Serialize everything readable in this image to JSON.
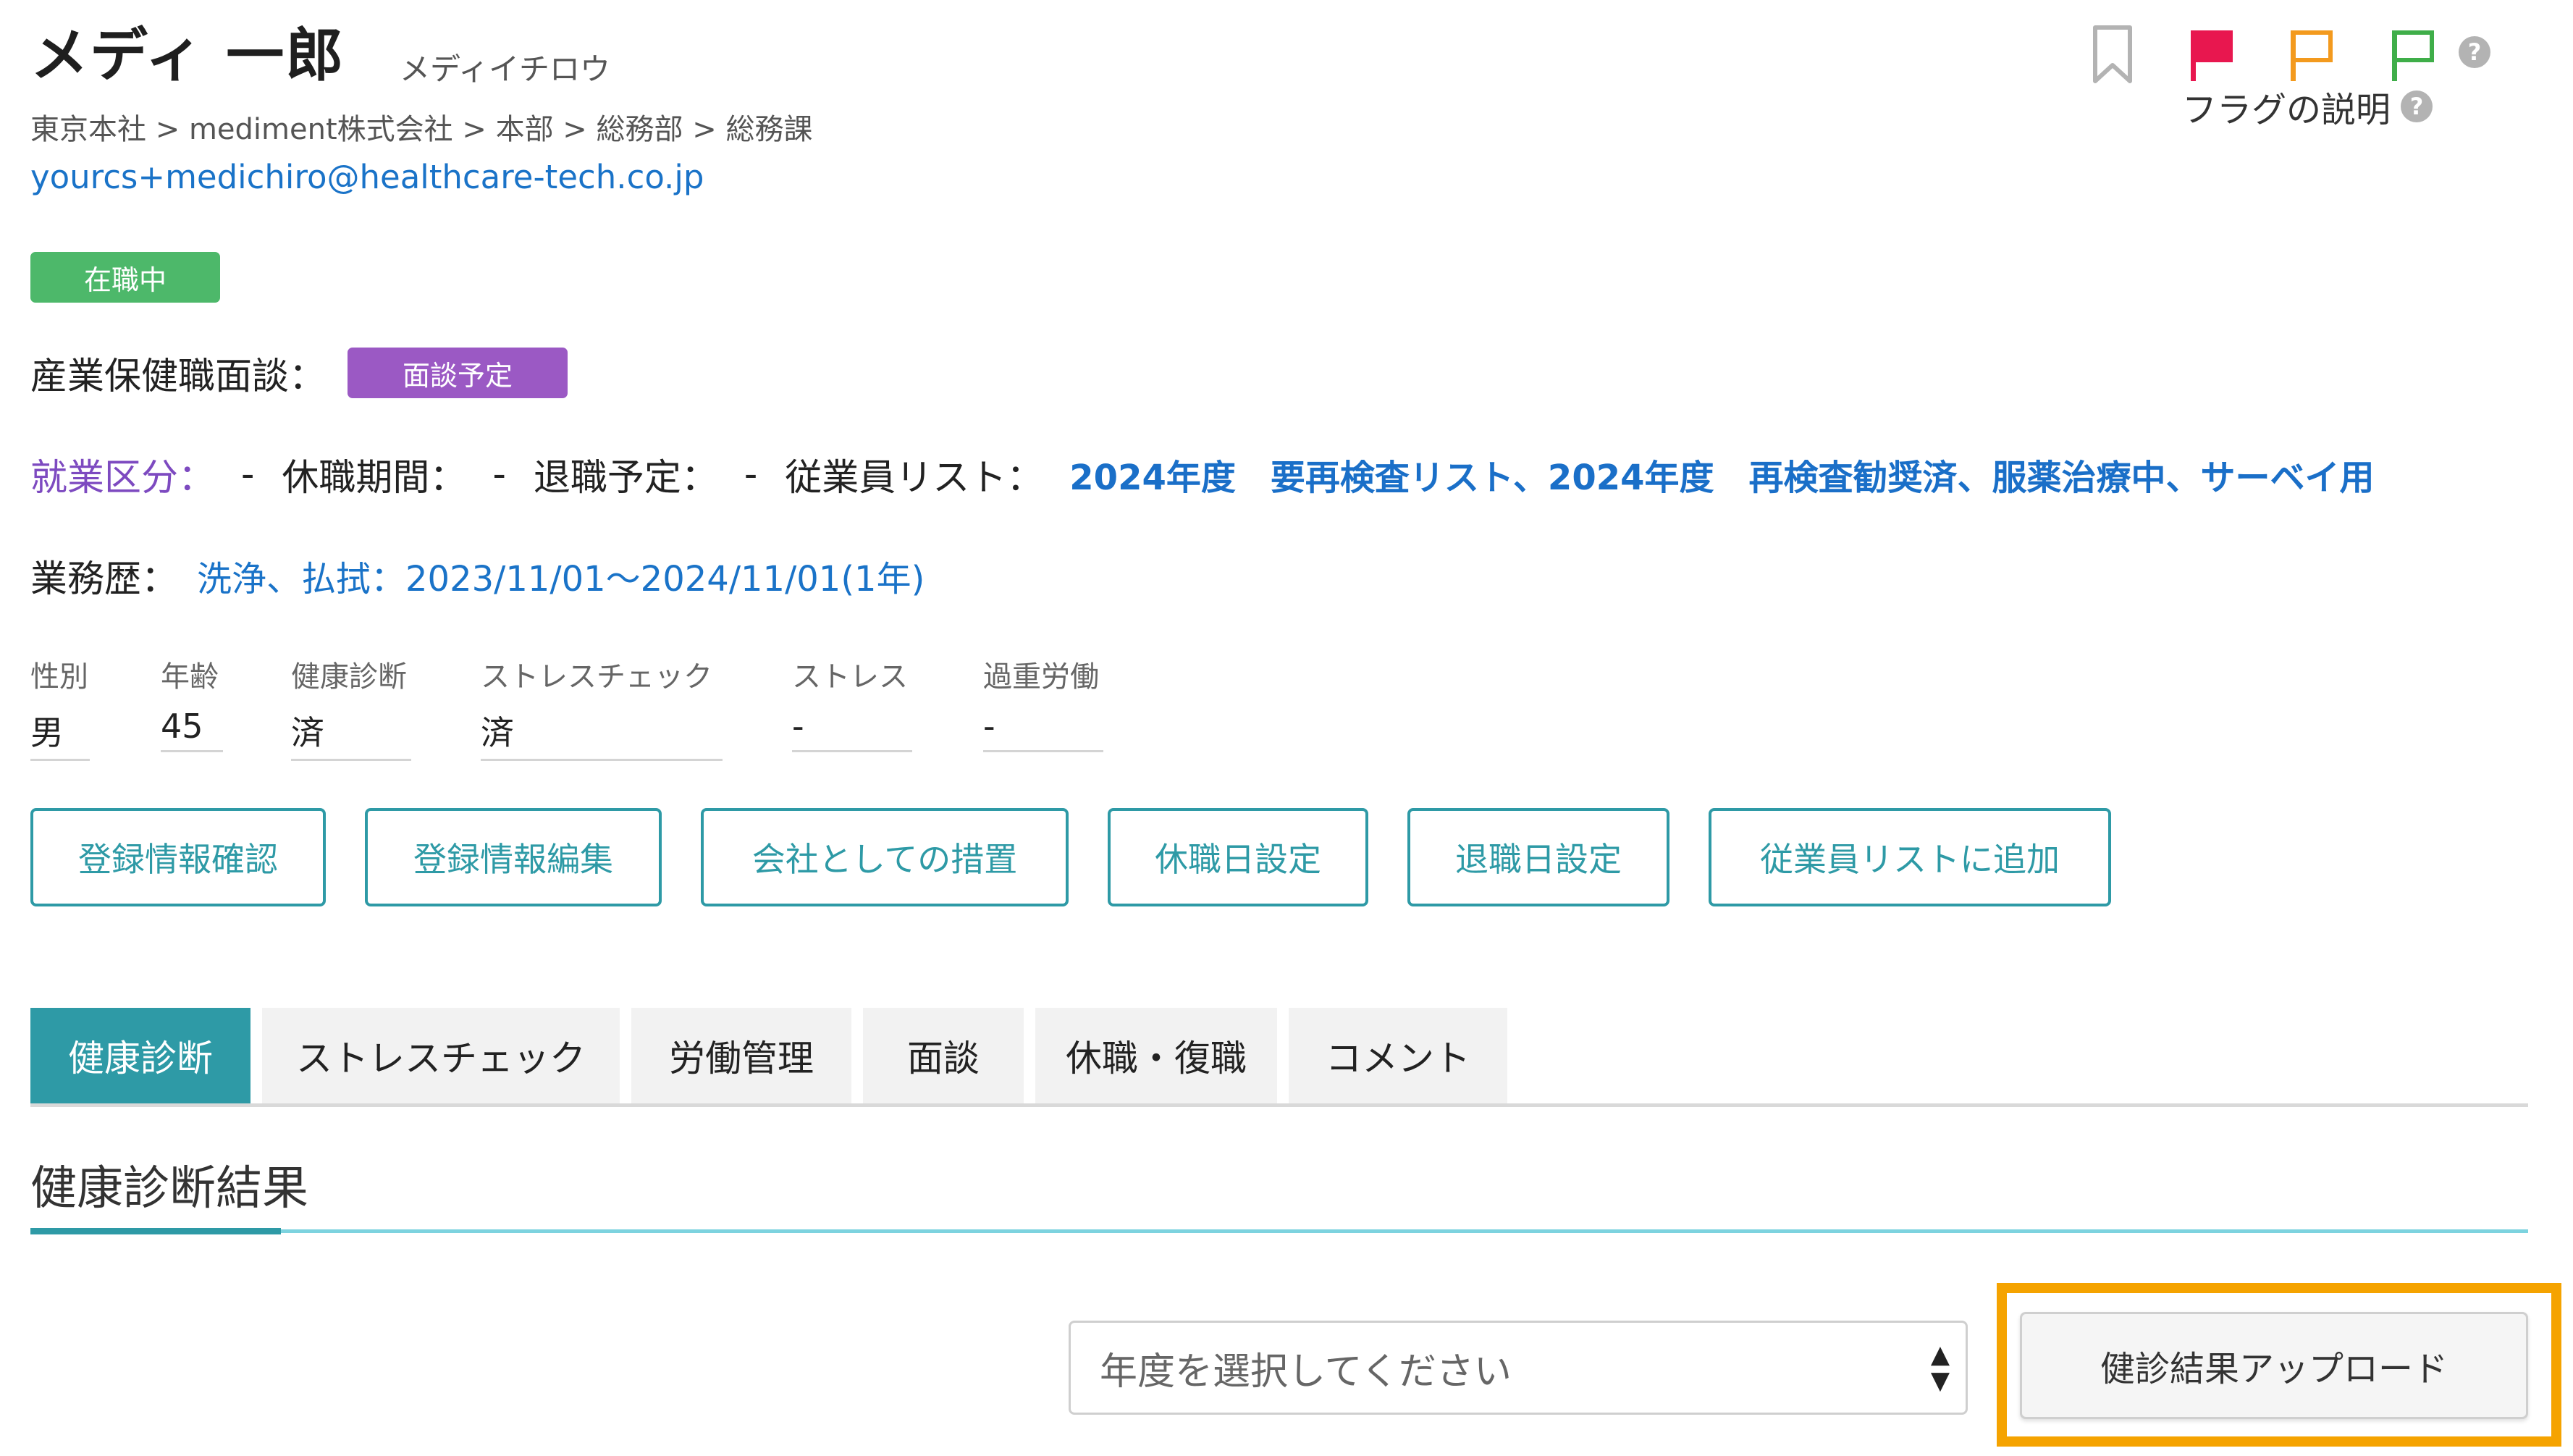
{
  "employee": {
    "name": "メディ 一郎",
    "kana": "メディイチロウ",
    "breadcrumb": "東京本社 > mediment株式会社 > 本部 > 総務部 > 総務課",
    "email": "yourcs+medichiro@healthcare-tech.co.jp",
    "status_badge": "在職中"
  },
  "flags": {
    "help_label": "フラグの説明",
    "colors": {
      "red": "#e8174f",
      "orange": "#f39a1e",
      "green": "#3fae49",
      "gray": "#b3b3b3"
    }
  },
  "meeting": {
    "label": "産業保健職面談：",
    "badge": "面談予定"
  },
  "work": {
    "category_label": "就業区分：",
    "category_value": "-",
    "leave_label": "休職期間：",
    "leave_value": "-",
    "retire_label": "退職予定：",
    "retire_value": "-",
    "list_label": "従業員リスト：",
    "list_value": "2024年度　要再検査リスト、2024年度　再検査勧奨済、服薬治療中、サーベイ用"
  },
  "history": {
    "label": "業務歴：",
    "value": "洗浄、払拭：2023/11/01～2024/11/01(1年)"
  },
  "info": [
    {
      "label": "性別",
      "value": "男"
    },
    {
      "label": "年齢",
      "value": "45"
    },
    {
      "label": "健康診断",
      "value": "済"
    },
    {
      "label": "ストレスチェック",
      "value": "済"
    },
    {
      "label": "ストレス",
      "value": "-"
    },
    {
      "label": "過重労働",
      "value": "-"
    }
  ],
  "actions": [
    "登録情報確認",
    "登録情報編集",
    "会社としての措置",
    "休職日設定",
    "退職日設定",
    "従業員リストに追加"
  ],
  "tabs": [
    "健康診断",
    "ストレスチェック",
    "労働管理",
    "面談",
    "休職・復職",
    "コメント"
  ],
  "section": {
    "title": "健康診断結果",
    "year_select_placeholder": "年度を選択してください",
    "upload_button": "健診結果アップロード"
  }
}
